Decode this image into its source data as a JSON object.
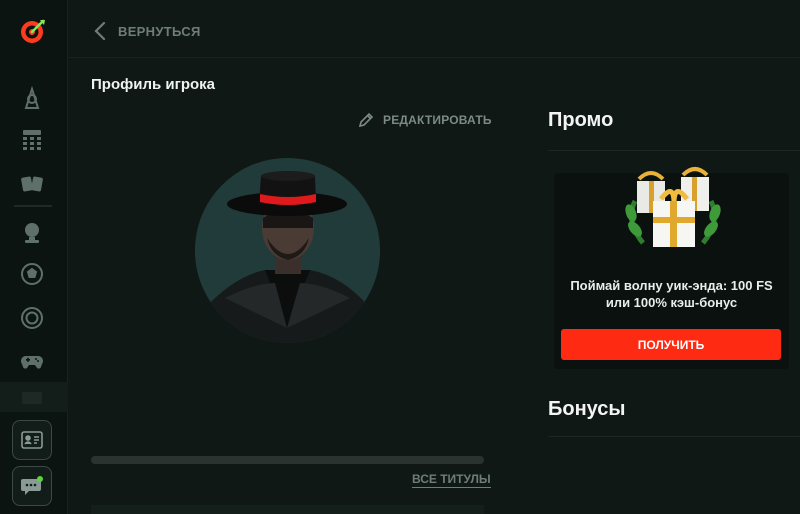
{
  "nav": {
    "back_label": "ВЕРНУТЬСЯ",
    "rail_items": [
      "fortune-icon",
      "bingo-icon",
      "cards-icon",
      "trophy-icon",
      "soccer-ball-icon",
      "target-icon",
      "gamepad-icon"
    ]
  },
  "profile": {
    "title": "Профиль игрока",
    "edit_label": "РЕДАКТИРОВАТЬ",
    "all_titles_label": "ВСЕ ТИТУЛЫ"
  },
  "promo": {
    "heading": "Промо",
    "card_text_line1": "Поймай волну уик-энда: 100 FS",
    "card_text_line2": "или 100% кэш-бонус",
    "cta_label": "ПОЛУЧИТЬ"
  },
  "bonuses": {
    "heading": "Бонусы"
  },
  "colors": {
    "accent": "#ff2a12",
    "background": "#0f1815",
    "muted_text": "#6f7d78"
  }
}
